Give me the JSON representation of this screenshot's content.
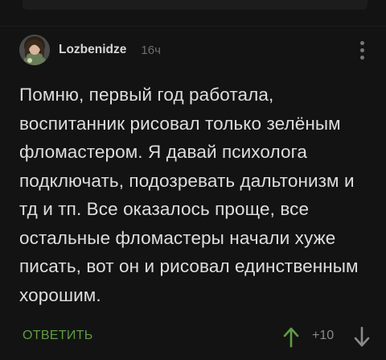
{
  "comment": {
    "author": "Lozbenidze",
    "time": "16ч",
    "text": "Помню, первый год работала, воспитанник рисовал только зелёным фломастером. Я давай психолога подключать, подозревать дальтонизм и тд и тп. Все оказалось проще, все остальные фломастеры начали хуже писать, вот он и рисовал единственным хорошим.",
    "reply_label": "ОТВЕТИТЬ",
    "rating": "+10",
    "avatar_icon": "user-avatar",
    "menu_icon": "more-vertical-icon",
    "upvote_icon": "arrow-up-icon",
    "downvote_icon": "arrow-down-icon"
  },
  "colors": {
    "background": "#131313",
    "text": "#dedede",
    "accent_green": "#5f9d42",
    "muted": "#6e6e6e"
  }
}
